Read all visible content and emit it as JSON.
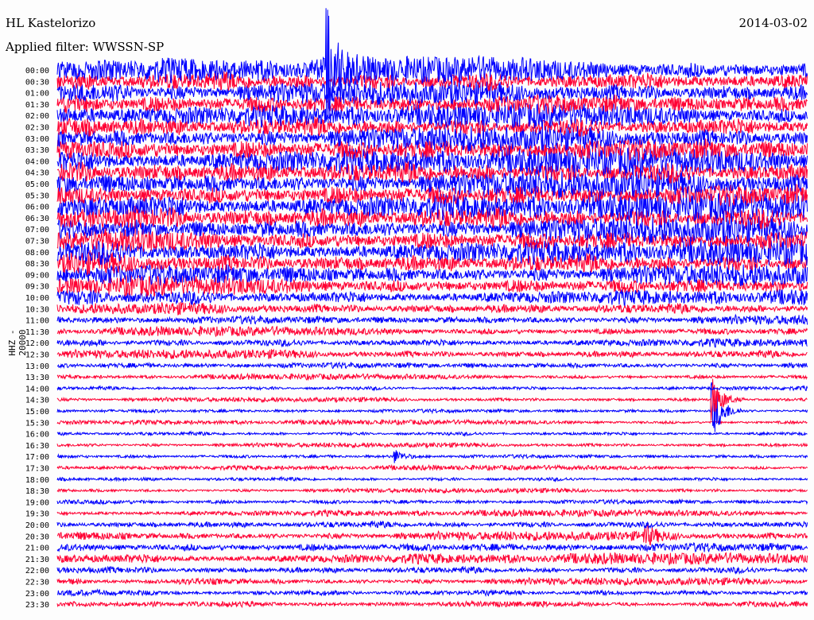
{
  "header": {
    "station": "HL Kastelorizo",
    "filter": "Applied filter: WWSSN-SP",
    "date": "2014-03-02"
  },
  "chart_data": {
    "type": "line",
    "title": "HL Kastelorizo",
    "subtitle": "Applied filter: WWSSN-SP",
    "date": "2014-03-02",
    "ylabel": "HHZ - 20000",
    "xlabel": "",
    "x_range_minutes": [
      0,
      30
    ],
    "row_labels": [
      "00:00",
      "00:30",
      "01:00",
      "01:30",
      "02:00",
      "02:30",
      "03:00",
      "03:30",
      "04:00",
      "04:30",
      "05:00",
      "05:30",
      "06:00",
      "06:30",
      "07:00",
      "07:30",
      "08:00",
      "08:30",
      "09:00",
      "09:30",
      "10:00",
      "10:30",
      "11:00",
      "11:30",
      "12:00",
      "12:30",
      "13:00",
      "13:30",
      "14:00",
      "14:30",
      "15:00",
      "15:30",
      "16:00",
      "16:30",
      "17:00",
      "17:30",
      "18:00",
      "18:30",
      "19:00",
      "19:30",
      "20:00",
      "20:30",
      "21:00",
      "21:30",
      "22:00",
      "22:30",
      "23:00",
      "23:30"
    ],
    "series_colors": [
      "#0000ff",
      "#ff0033"
    ],
    "relative_noise_amplitude": [
      1.4,
      1.3,
      1.3,
      1.3,
      1.3,
      1.3,
      1.4,
      1.5,
      1.5,
      1.5,
      1.5,
      1.5,
      1.5,
      1.5,
      1.5,
      1.4,
      1.4,
      1.3,
      1.2,
      1.1,
      0.9,
      0.7,
      0.55,
      0.5,
      0.5,
      0.5,
      0.4,
      0.3,
      0.25,
      0.25,
      0.25,
      0.25,
      0.25,
      0.25,
      0.25,
      0.25,
      0.25,
      0.25,
      0.3,
      0.35,
      0.45,
      0.5,
      0.6,
      0.6,
      0.45,
      0.4,
      0.35,
      0.3
    ],
    "events": [
      {
        "row": 30,
        "minute": 26.2,
        "amplitude": 2.5
      },
      {
        "row": 29,
        "minute": 26.2,
        "amplitude": 1.8
      },
      {
        "row": 34,
        "minute": 13.5,
        "amplitude": 0.6
      },
      {
        "row": 41,
        "minute": 23.5,
        "amplitude": 0.9
      },
      {
        "row": 0,
        "minute": 10.8,
        "amplitude": 4.5
      }
    ]
  }
}
